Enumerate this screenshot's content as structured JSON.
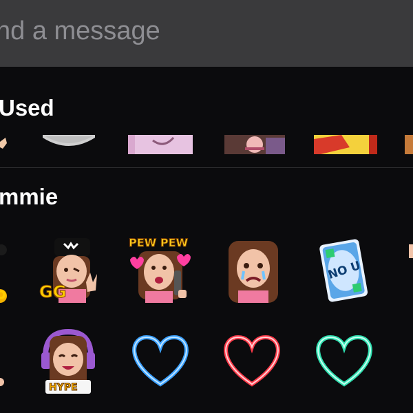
{
  "message_input": {
    "placeholder": "nd a message"
  },
  "sections": {
    "recently_used": {
      "title": "Used"
    },
    "channel_emotes": {
      "title": "mmie"
    }
  },
  "emotes": {
    "partial_gg": "o",
    "gg": "GG",
    "pew_pew": "PEW PEW",
    "no_u_card": "NO U",
    "hype": "HYPE"
  },
  "colors": {
    "input_bg": "#3a3a3c",
    "placeholder": "#8e8e93",
    "background": "#0b0b0d",
    "heart_blue": "#3aa0ff",
    "heart_red": "#ff3b4a",
    "heart_green": "#2fe0b0"
  }
}
